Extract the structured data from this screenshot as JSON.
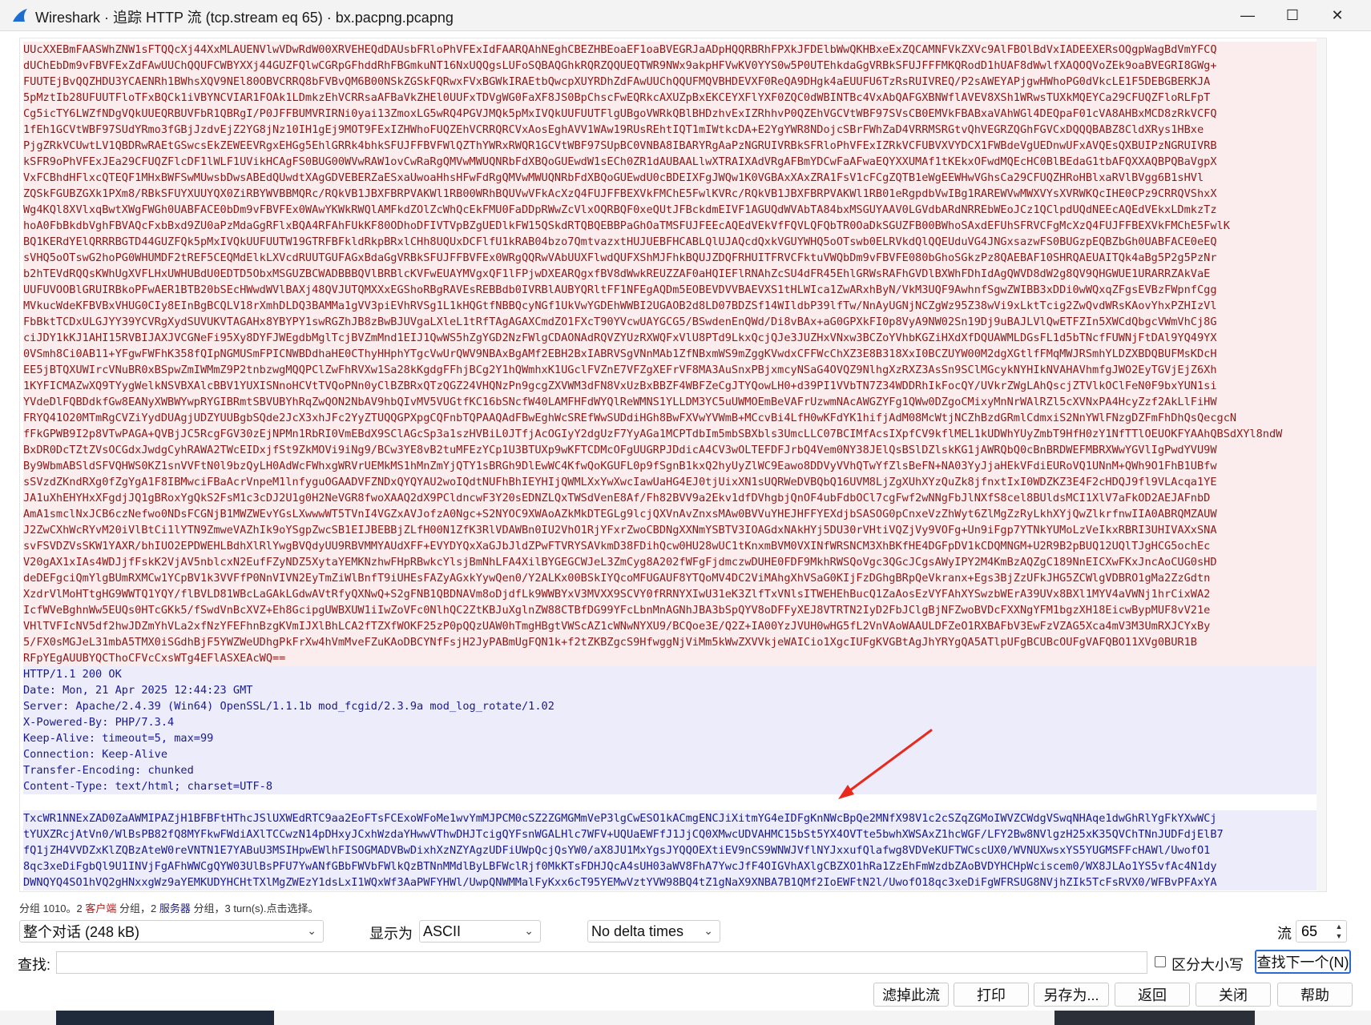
{
  "window": {
    "title": "Wireshark · 追踪 HTTP 流 (tcp.stream eq 65) · bx.pacpng.pcapng",
    "icons": {
      "app": "wireshark-fin-icon",
      "minimize": "minimize-icon",
      "maximize": "maximize-icon",
      "close": "close-icon"
    },
    "glyphs": {
      "minimize": "—",
      "maximize": "☐",
      "close": "✕"
    }
  },
  "stream": {
    "client_lines": [
      "UUcXXEBmFAASWhZNW1sFTQQcXj44XxMLAUENVlwVDwRdW00XRVEHEQdDAUsbFRloPhVFExIdFAARQAhNEghCBEZHBEoaEF1oaBVEGRJaADpHQQRBRhFPXkJFDElbWwQKHBxeExZQCAMNFVkZXVc9AlFBOlBdVxIADEEXERsOQgpWagBdVmYFCQ",
      "dUChEbDm9vFBVFExZdFAwUUChQQUFCWBYXXj44GUZFQlwCGRpGFhddRhFBGmkuNT16NxUQQgsLUFoSQBAQGhkRQRZQQUEQTWR9NWx9akpHFVwKV0YYS0w5P0UTEhkdaGgVRBkSFUJFFFMKQRodD1hUAF8dWwlfXAQOQVoZEk9oaBVEGRI8GWg+",
      "FUUTEjBvQQZHDU3YCAENRh1BWhsXQV9NEl80OBVCRRQ8bFVBvQM6B00NSkZGSkFQRwxFVxBGWkIRAEtbQwcpXUYRDhZdFAwUUChQQUFMQVBHDEVXF0ReQA9DHgk4aEUUFU6TzRsRUIVREQ/P2sAWEYAPjgwHWhoPG0dVkcLE1F5DEBGBERKJA",
      "5pMztIb28UFUUTFloTFxBQCk1iVBYNCVIAR1FOAk1LDmkzEhVCRRsaAFBaVkZHEl0UUFxTDVgWG0FaXF8JS0BpChscFwEQRkcAXUZpBxEKCEYXFlYXF0ZQC0dWBINTBc4VxAbQAFGXBNWflAVEV8XSh1WRwsTUXkMQEYCa29CFUQZFloRLFpT",
      "Cg5icTY6LWZfNDgVQkUUEQRBUVFbR1QBRgI/P0JFFBUMVRIRNi0yai13ZmoxLG5wRQ4PGVJMQk5pMxIVQkUUFUUTFlgUBgoVWRkQBlBHDzhvExIZRhhvP0QZEhVGCVtWBF97SVsCB0EMVkFBABxaVAhWGl4DEQpaF01cVA8AHBxMCD8zRkVCFQ",
      "1fEh1GCVtWBF97SUdYRmo3fGBjJzdvEjZ2YG8jNz10IH1gEj9MOT9FExIZHWhoFUQZEhVCRRQRCVxAosEghAVV1WAw19RUsREhtIQT1mIWtkcDA+E2YgYWR8NDojcSBrFWhZaD4VRRMSRGtvQhVEGRZQGhFGVCxDQQQBABZ8CldXRys1HBxe",
      "PjgZRkVCUwtLV1QBDRwRAEtGSwcsEkZEWEEVRgxEHGg5EhlGRRk4bhkSFUJFFBVFWlQZThYWRxRWQR1GCVtWBF97SUpBC0VNBA8IBARYRgAaPzNGRUIVRBkSFRloPhVFExIZRkVCFUBVXVYDCX1FWBdeVgUEDnwUFxAVQEsQXBUIPzNGRUIVRB",
      "kSFR9oPhVFExJEa29CFUQZFlcDF1lWLF1UVikHCAgFS0BUG00WVwRAW1ovCwRaRgQMVwMWUQNRbFdXBQoGUEwdW1sECh0ZR1dAUBAALlwXTRAIXAdVRgAFBmYDCwFaAFwaEQYXXUMAf1tKEkxOFwdMQEcHC0BlBEdaG1tbAFQXXAQBPQBaVgpX",
      "VxFCBhdHFlxcQTEQF1MHxBWFSwMUwsbDwsABEdQUwdtXAgGDVEBERZaESxaUwoaHhsHFwFdRgQMVwMWUQNRbFdXBQoGUEwdU0cBDEIXFgJWQw1K0VGBAxXAxZRA1FsV1cFCgZQTB1eWgEEWHwVGhsCa29CFUQZHRoHBlxaRVlBVgg6B1sHVl",
      "ZQSkFGUBZGXk1PXm8/RBkSFUYXUUYQX0ZiRBYWVBBMQRc/RQkVB1JBXFBRPVAKWl1RB00WRhBQUVwVFkAcXzQ4FUJFFBEXVkFMChE5FwlKVRc/RQkVB1JBXFBRPVAKWl1RB01eRgpdbVwIBg1RAREWVwMWXVYsXVRWKQcIHE0CPz9CRRQVShxX",
      "Wg4KQl8XVlxqBwtXWgFWGh0UABFACE0bDm9vFBVFEx0WAwYKWkRWQlAMFkdZOlZcWhQcEkFMU0FaDDpRWwZcVlxOQRBQF0xeQUtJFBckdmEIVF1AGUQdWVAbTA84bxMSGUYAAV0LGVdbARdNRREbWEoJCz1QClpdUQdNEEcAQEdVEkxLDmkzTz",
      "hoA0FbBkdbVghFBVAQcFxbBxd9ZU0aPzMdaGgRFlxBQA4RFAhFUkKF80ODhoDFIVTVpBZgUEDlkFW15QSkdRTQBQEBBPaGhOaTMSFUJFEEcAQEdVEkVfFQVLQFQbTR0OaDkSGUZFB00BWhoSAxdEFUhSFRVCFgMcXzQ4FUJFFBEXVkFMChE5FwlK",
      "BQ1KERdYElQRRRBGTD44GUZFQk5pMxIVQkUUFUUTW19GTRFBFkldRkpBRxlCHh8UQUxDCFlfU1kRAB04bzo7QmtvazxtHUJUEBFHCABLQlUJAQcdQxkVGUYWHQ5oOTswb0ELRVkdQlQQEUduVG4JNGxsazwFS0BUGzpEQBZbGh0UABFACE0eEQ",
      "sVHQ5oOTswG2hoPG0WHUMDF2tREF5CEQMdElkLXVcdRUUTGUFAGxBdaGgVRBkSFUJFFBVFEx0WRgQQRwVAbUUXFlwdQUFXShMJFhkBQUJZDQFRHUITFRVCFktuVWQbDm9vFBVFE080bGhoSGkzPz8QAEBAF10SHRQAEUAITQk4aBg5P2g5PzNr",
      "b2hTEVdRQQsKWhUgXVFLHxUWHUBdU0EDTD5ObxMSGUZBCWADBBBQVlBRBlcKVFwEUAYMVgxQF1lFPjwDXEARQgxfBV8dWwkREUZZAF0aHQIEFlRNAhZcSU4dFR45EhlGRWsRAFhGVDlBXWhFDhIdAgQWVD8dW2g8QV9QHGWUE1URARRZAkVaE",
      "UUFUVOOBlGRUIRBkoPFwAER1BTB20bSEcHWwdWVlBAXj48QVJUTQMXXxEGShoRBgRAVEsREBBdb0IVRBlAUBYQRltFF1NFEgAQDm5EOBEVDVVBAEVXS1tHLWIca1ZwARxhByN/VkM3UQF9AwhnfSgwZWIBB3xDDi0wWQxqZFgsEVBzFWpnfCgg",
      "MVkucWdeKFBVBxVHUG0CIy8EInBgBCQLV18rXmhDLDQ3BAMMa1gVV3piEVhRVSg1L1kHQGtfNBBQcyNGf1UkVwYGDEhWWBI2UGAOB2d8LD07BDZSf14WIldbP39lfTw/NnAyUGNjNCZgWz95Z38wVi9xLktTcig2ZwQvdWRsKAovYhxPZHIzVl",
      "FbBktTCDxULGJYY39YCVRgXydSUVUKVTAGAHx8YBYPY1swRGZhJB8zBwBJUVgaLXleL1tRfTAgAGAXCmdZO1FXcT90YVcwUAYGCG5/BSwdenEnQWd/Di8vBAx+aG0GPXkFI0p8VyA9NW02Sn19Dj9uBAJLVlQwETFZIn5XWCdQbgcVWmVhCj8G",
      "ciJDY1kKJ1AHI15RVBIJAXJVCGNeFi95Xy8DYFJWEgdbMglTcjBVZmMnd1EIJ1QwWS5hZgYGD2NzFWlgCDAONAdRQVZYUzRXWQFxVlU8PTd9LkxQcjQJe3JUZHxVNxw3BCZoYVhbKGZiHXdXfDQUAWMLDGsFL1d5bTNcfFUWNjFtDAl9YQ49YX",
      "0VSmh8Ci0AB11+YFgwFWFhK358fQIpNGMUSmFPICNWBDdhaHE0CThyHHphYTgcVwUrQWV9NBAxBgAMf2EBH2BxIABRVSgVNnMAb1ZfNBxmWS9mZggKVwdxCFFWcChXZ3E8B318XxI0BCZUYW00M2dgXGtlfFMqMWJRSmhYLDZXBDQBUFMsKDcH",
      "EE5jBTQXUWIrcVNuBR0xBSpwZmIWMmZ9P2tnbzwgMQQPClZwFhRVXw1Sa28kKgdgFFhjBCg2Y1hQWmhxK1UGclFVZnE7VFZgXEFrVF8MA3AuSnxPBjxmcyNSaG4OVQZ9NlhgXzRXZ3AsSn9SClMGcykNYHIkNVAHAVhmfgJWO2EyTGVjEjZ6Xh",
      "1KYFICMAZwXQ9TYygWelkNSVBXAlcBBV1YUXISNnoHCVtTVQoPNn0yClBZBRxQTzQGZ24VHQNzPn9gcgZXVWM3dFN8VxUzBxBBZF4WBFZeCgJTYQowLH0+d39PI1VVbTN7Z34WDDRhIkFocQY/UVkrZWgLAhQscjZTVlkOClFeN0F9bxYUN1si",
      "YVdeDlFQBDdkfGw8EANyXWBWYwpRYGIBRmtSBVUBYhRqZwQON2NbAV9hbQIvMV5VUGtfKC16bSNcfW40LAMFHFdWYQlReWMNS1YLLDM3YC5uUWMOEmBeVAFrUzwmNAcAWGZYFg1QWw0DZgoCMixyMnNrWAlRZl5cXVNxPA4HcyZzf2AkLlFiHW",
      "FRYQ41O20MTmRgCVZiYydDUAgjUDZYUUBgbSQde2JcX3xhJFc2YyZTUQQGPXpgCQFnbTQPAAQAdFBwEghWcSREfWwSUDdiHGh8BwFXVwYVWmB+MCcvBi4LfH0wKFdYK1hifjAdM08McWtjNCZhBzdGRmlCdmxiS2NnYWlFNzgDZFmFhDhQsQecgcN",
      "fFkGPWB9I2p8VTwPAGA+QVBjJC5RcgFGV30zEjNPMn1RbRI0VmEBdX9SClAGcSp3a1szHVBiL0JTfjAcOGIyY2dgUzF7YyAGa1MCPTdbIm5mbSBXbls3UmcLLC07BCIMfAcsIXpfCV9kflMEL1kUDWhYUyZmbT9HfH0zY1NfTTlOEUOKFYAAhQBSdXYl8ndW",
      "BxDR0DcTZtZVsOCGdxJwdgCyhRAWA2TWcEIDxjfSt9ZkMOVi9iNg9/BCw3YE8vB2tuMFEzYCp1U3BTUXp9wKFTCDMcOFgUUGRPJDdicA4CV3wOLTEFDFJrbQ4Vem0NY38JElQsBSlDZlskKG1jAWRQbQ0cBnBRDWEFMBRXWwYGVlIgPwdYVU9W",
      "By9WbmABSldSFVQHWS0KZ1snVVFtN0l9bzQyLH0AdWcFWhxgWRVrUEMkMS1hMnZmYjQTY1sBRGh9DlEwWC4KfwQoKGUFL0p9fSgnB1kxQ2hyUyZlWC9Eawo8DDVyVVhQTwYfZlsBeFN+NA03YyJjaHEkVFdiEURoVQ1UNnM+QWh9O1FhB1UBfw",
      "sSVzdZKndRXg0fZgYgA1F8IBMwciFBaAcrVnpeM1lnfyguOGAADVFZNDxQYQYAU2woIQdtNUFhBhIEYHIjQWMLXxYwXwcIawUaHG4EJ0tjUixXN1sUQRWeDVBQbQ16UVM8LjZgXUhXYzQuZk8jfnxtIxI0WDZKZ3E4F2cHDQJ9fl9VLAcqa1YE",
      "JA1uXhEHYHxXFgdjJQ1gBRoxYgQkS2FsM1c3cDJ2U1g0H2NeVGR8fwoXAAQ2dX9PCldncwF3Y20sEDNZLQxTWSdVenE8Af/Fh82BVV9a2Ekv1dfDVhgbjQnOF4ubFdbOCl7cgFwf2wNNgFbJlNXfS8cel8BUldsMCI1XlV7aFkOD2AEJAFnbD",
      "AmA1smclNxJCB6czNefwo0NDsFCGNjB1MWZWEvYGsLXwwwWT5TVnI4VGZxAVJofzA0Ngc+S2NYOC9XWAoAZkMkDTEGLg9lcjQXVnAvZnxsMAw0BVVuYHEJHFFYEXdjbSASOG0pCnxeVzZhWyt6ZlMgZzRyLkhXYjQwZlkrfnwIIA0ABRQMZAUW",
      "J2ZwCXhWcRYvM20iVlBtCi1lYTN9ZmweVAZhIk9oYSgpZwcSB1EIJBEBBjZLfH00N1ZfK3RlVDAWBn0IU2VhO1RjYFxrZwoCBDNgXXNmYSBTV3IOAGdxNAkHYj5DU30rVHtiVQZjVy9VOFg+Un9iFgp7YTNkYUMoLzVeIkxRBRI3UHIVAXxSNA",
      "svFSVDZVsSKW1YAXR/bhIUO2EPDWEHLBdhXlRlYwgBVQdyUU9RBVMMYAUdXFF+EVYDYQxXaGJbJldZPwFTVRYSAVkmD38FDihQcw0HU28wUC1tKnxmBVM0VXINfWRSNCM3XhBKfHE4DGFpDV1kCDQMNGM+U2R9B2pBUQ12UQlTJgHCG5ochEc",
      "V20gAX1xIAs4WDJjfFskK2VjAV5nblcxN2EufFZyNDZ5XytaYEMKNzhwFHpRBwkcYlsjBmNhLFA4XilBYGEGCWJeL3ZmCyg8A202fWFgFjdmczwDUHE0FDF9MkhRWSQoVgc3QGcJCgsAWyIPY2M4KmBzAQZgC189NnEICXwFKxJncAoCUG0sHD",
      "deDEFgciQmYlgBUmRXMCw1YCpBV1k3VVFfP0NnVIVN2EyTmZiWlBnfT9iUHEsFAZyAGxkYywQen0/Y2ALKx00BSkIYQcoMFUGAUF8YTQoMV4DC2ViMAhgXhVSaG0KIjFzDGhgBRpQeVkranx+Egs3BjZzUFkJHG5ZCWlgVDBRO1gMa2ZzGdtn",
      "XzdrVlMoHTtgHG9WWTQ1YQY/flBVLD81WBcLaGAkLGdwAVtRfyQXNwQ+S2gFNB1QBDNAVm8oDjdfLk9WWBYxV3MVXX9SCVY0fRRNYXIwU31eK3ZlfTxVNlsITWEHEhBucQ1ZaAosEzVYFAhXYSwzbWErA39UVx8BXl1MYV4aVWNj1hrCixWA2",
      "IcfWVeBghnWw5EUQs0HTcGKk5/fSwdVnBcXVZ+Eh8GcipgUWBXUW1iIwZoVFc0NlhQC2ZtKBJuXglnZW88CTBfDG99YFcLbnMnAGNhJBA3bSpQYV8oDFFyXEJ8VTRTN2IyD2FbJClgBjNFZwoBVDcFXXNgYFM1bgzXH18EicwBypMUF8vV21e",
      "VHlTVFIcNV5df2hwJDZmYhVLa2xfNzYFEFhnBzgKVmIJXlBhLCA2fTZXfWOKF25zP0pQQzUAW0hTmgHBgtVWScAZ1cWNwNYXU9/BCQoe3E/Q2Z+IA00YzJVUH0wHG5fL2VnVAoWAAULDFZeO1RXBAFbV3EwFzVZAG5Xca4mV3M3UmRXJCYxBy",
      "5/FX0sMGJeL31mbA5TMX0iSGdhBjF5YWZWeUDhgPkFrXw4hVmMveFZuKAoDBCYNfFsjH2JyPABmUgFQN1k+f2tZKBZgcS9HfwggNjViMm5kWwZXVVkjeWAICio1XgcIUFgKVGBtAgJhYRYgQA5ATlpUFgBCUBcOUFgVAFQBO11XVg0BUR1B",
      "RFpYEgAUUBYQCThoCFVcCxsWTg4EFlASXEAcWQ=="
    ],
    "server_lines": [
      "HTTP/1.1 200 OK",
      "Date: Mon, 21 Apr 2025 12:44:23 GMT",
      "Server: Apache/2.4.39 (Win64) OpenSSL/1.1.1b mod_fcgid/2.3.9a mod_log_rotate/1.02",
      "X-Powered-By: PHP/7.3.4",
      "Keep-Alive: timeout=5, max=99",
      "Connection: Keep-Alive",
      "Transfer-Encoding: chunked",
      "Content-Type: text/html; charset=UTF-8",
      "",
      "TxcWR1NNExZAD0ZaAWMIPAZjH1BFBFtHThcJSlUXWEdRTC9aa2EoFTsFCExoWFoMe1wvYmMJPCM0cSZ2ZGMGMmVeP3lgCwESO1kACmgENCJiXitmYG4eIDFgKnNWcBpQe2MNfX98V1c2cSZqZGMoIWVZCWdgVSwqNHAqe1dwGhRlYgFkYXwWCj",
      "tYUXZRcjAtVn0/WlBsPB82fQ8MYFkwFWdiAXlTCCwzN14pDHxyJCxhWzdaYHwwVThwDHJTcigQYFsnWGALHlc7WFV+UQUaEWFfJ1JjCQ0XMwcUDVAHMC15bSt5YX4OVTte5bwhXWSAxZ1hcWGF/LFY2Bw8NVlgzH25xK35QVChTNnJUDFdjElB7",
      "fQ1jZH4VVDZxKlZQBzAteW0reVNTN1E7YABuU3MSIHpwEWlhFISOGMADVBwDixhXzNZYAgzUDFiUWpQcjQsYW0/aX8JU1MxYgsJYQQOEXtiEV9nCS9WNWJVflNYJxxufQlafwg8VDVeKUFTWCscUX0/WVNUXwsxYS5YUGMSFFcHAWl/UwofO1",
      "8qc3xeDiFgbQl9U1INVjFgAFhWWCgQYW03UlBsPFU7YwANfGBbFWVbFWlkQzBTNnMMdlByLBFWclRjf0MkKTsFDHJQcA4sUH03aWV8FhA7YwcJfF4OIGVhAXlgCBZXO1hRa1ZzEhFmWzdbZAoBVDYHCHpWciscem0/WX8JLAo1YS5vfAc4N1dy",
      "DWNQYQ4SO1hVQ2gHNxxgWz9aYEMKUDYHCHtTXlMgZWEzY1dsLxI1WQxWf3AaPWFYHWl/UwpQNWMMalFyKxx6cT95YEMwVztYVW98BQ4tZ1gNaX9XNBA7B1QMf2IoEWFtN2l/UwofO18qc3xeDiFgWFRSUG8NVjhZIk5TcFsRVX0/WFBvPFAxYA"
    ]
  },
  "status": {
    "prefix": "分组 1010。2 ",
    "client_word": "客户端",
    "mid": " 分组，2 ",
    "server_word": "服务器",
    "suffix": " 分组，3 turn(s).点击选择。"
  },
  "controls": {
    "conversation": "整个对话 (248 kB)",
    "display_as_label": "显示为",
    "display_as": "ASCII",
    "delta": "No delta times",
    "stream_label": "流",
    "stream_value": "65",
    "chevron": "⌄",
    "up": "▲",
    "down": "▼"
  },
  "find": {
    "label": "查找:",
    "value": "",
    "placeholder": "",
    "case_label": "区分大小写",
    "next_button": "查找下一个(N)"
  },
  "buttons": {
    "filter_out": "滤掉此流",
    "print": "打印",
    "save_as": "另存为...",
    "back": "返回",
    "close": "关闭",
    "help": "帮助"
  },
  "colors": {
    "client_bg": "#fbeded",
    "client_fg": "#8a1a1a",
    "server_bg": "#ececfb",
    "server_fg": "#1a1a8a",
    "arrow": "#e8291c",
    "focus": "#2a6bd1"
  }
}
